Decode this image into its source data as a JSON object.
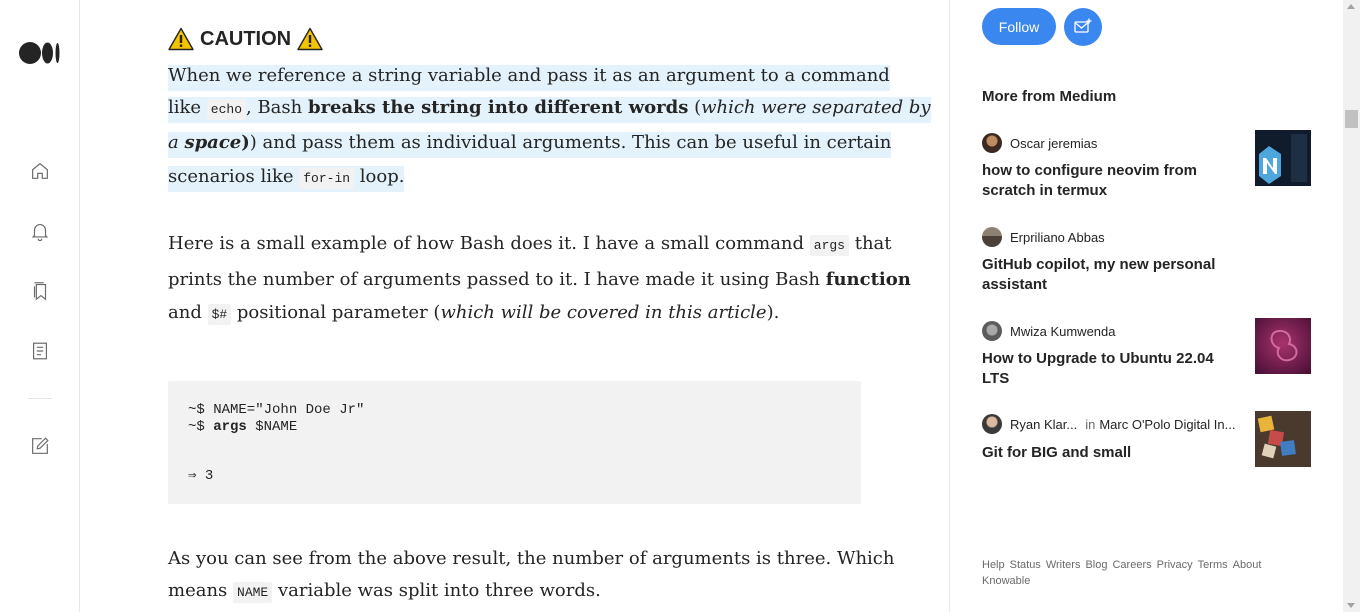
{
  "nav": {
    "logo": "medium-logo",
    "items": [
      "home-icon",
      "bell-icon",
      "bookmarks-icon",
      "stories-icon",
      "write-icon"
    ]
  },
  "article": {
    "caution_label": "CAUTION",
    "p1": {
      "l1": "When we reference a string variable and pass it as an argument to a command",
      "l2a": "like ",
      "l2code": "echo",
      "l2b": ", Bash ",
      "l2bold": "breaks the string into different words",
      "l2c": " (",
      "l2ital": "which were separated by",
      "l3ital": "a ",
      "l3bolditalic": "space",
      "l3a": ") and pass them as individual arguments. This can be useful in certain",
      "l4a": "scenarios like ",
      "l4code": "for-in",
      "l4b": " loop."
    },
    "p2": {
      "l1a": "Here is a small example of how Bash does it. I have a small command ",
      "l1code": "args",
      "l1b": " that",
      "l2a": "prints the number of arguments passed to it. I have made it using Bash ",
      "l2bold": "function",
      "l3a": "and ",
      "l3code": "$#",
      "l3b": " positional parameter (",
      "l3ital": "which will be covered in this article",
      "l3c": ")."
    },
    "code": {
      "line1": "~$ NAME=\"John Doe Jr\"",
      "line2_prefix": "~$ ",
      "line2_cmd": "args",
      "line2_rest": " $NAME",
      "line3": "⇒ 3"
    },
    "p3": {
      "l1": "As you can see from the above result, the number of arguments is three. Which",
      "l2a": "means ",
      "l2code": "NAME",
      "l2b": " variable was split into three words."
    }
  },
  "sidebar": {
    "follow_label": "Follow",
    "more_title": "More from Medium",
    "recs": [
      {
        "author": "Oscar jeremias",
        "title": "how to configure neovim from scratch in termux"
      },
      {
        "author": "Erpriliano Abbas",
        "title": "GitHub copilot, my new personal assistant"
      },
      {
        "author": "Mwiza Kumwenda",
        "title": "How to Upgrade to Ubuntu 22.04 LTS"
      },
      {
        "author": "Ryan Klar...",
        "in_label": "in",
        "publication": "Marc O'Polo Digital In...",
        "title": "Git for BIG and small"
      }
    ],
    "footer": [
      "Help",
      "Status",
      "Writers",
      "Blog",
      "Careers",
      "Privacy",
      "Terms",
      "About",
      "Knowable"
    ]
  },
  "colors": {
    "accent": "#3b87f0",
    "highlight": "#e3f2fb",
    "code_bg": "#f2f2f2",
    "text": "#242424",
    "muted": "#6b6b6b"
  }
}
